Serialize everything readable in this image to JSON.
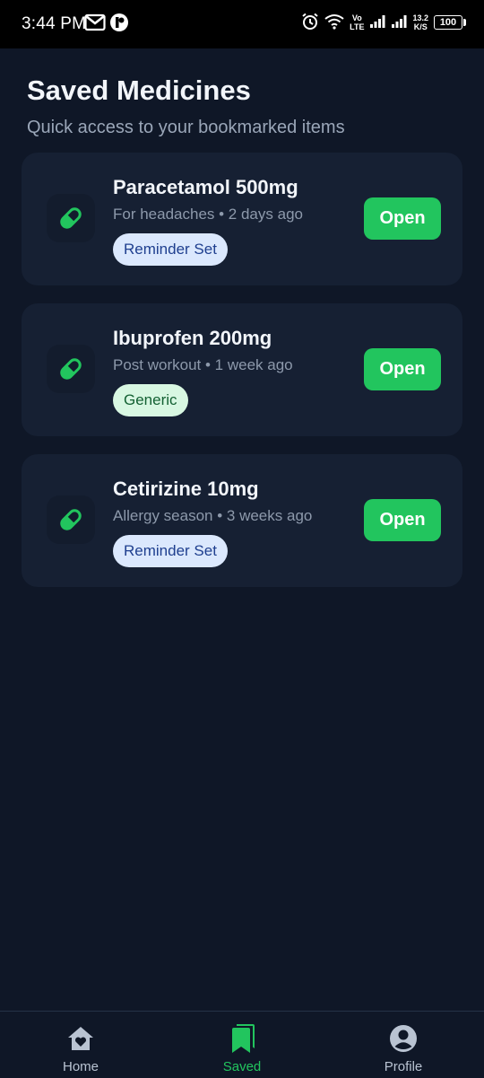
{
  "status_bar": {
    "time": "3:44 PM",
    "net_speed_value": "13.2",
    "net_speed_unit": "K/S",
    "battery": "100",
    "volte_top": "Vo",
    "volte_bottom": "LTE"
  },
  "header": {
    "title": "Saved Medicines",
    "subtitle": "Quick access to your bookmarked items"
  },
  "medicines": [
    {
      "name": "Paracetamol 500mg",
      "meta": "For headaches • 2 days ago",
      "badge": "Reminder Set",
      "badge_type": "reminder",
      "button": "Open"
    },
    {
      "name": "Ibuprofen 200mg",
      "meta": "Post workout • 1 week ago",
      "badge": "Generic",
      "badge_type": "generic",
      "button": "Open"
    },
    {
      "name": "Cetirizine 10mg",
      "meta": "Allergy season • 3 weeks ago",
      "badge": "Reminder Set",
      "badge_type": "reminder",
      "button": "Open"
    }
  ],
  "nav": {
    "items": [
      {
        "label": "Home",
        "icon": "home-icon",
        "active": false
      },
      {
        "label": "Saved",
        "icon": "bookmark-icon",
        "active": true
      },
      {
        "label": "Profile",
        "icon": "profile-icon",
        "active": false
      }
    ]
  },
  "colors": {
    "background": "#0f1727",
    "card": "#162033",
    "accent_green": "#22c55e",
    "badge_reminder_bg": "#dbe8fd",
    "badge_generic_bg": "#d8f7e2"
  }
}
